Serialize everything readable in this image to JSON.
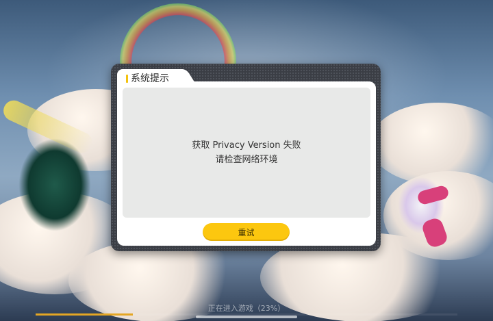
{
  "dialog": {
    "title": "系统提示",
    "message_line1": "获取 Privacy Version 失败",
    "message_line2": "请检查网络环境",
    "retry_label": "重试"
  },
  "loading": {
    "text": "正在进入游戏（23%）",
    "progress": 0.23
  },
  "colors": {
    "accent": "#fcc70f",
    "progress": "#e4a624"
  }
}
